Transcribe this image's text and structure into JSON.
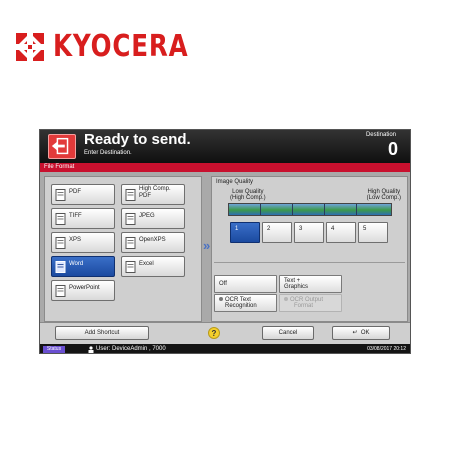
{
  "brand": {
    "name": "KYOCERA",
    "color": "#d81e1e"
  },
  "header": {
    "icon": "send-icon",
    "title": "Ready to send.",
    "subtitle": "Enter Destination.",
    "destination_label": "Destination",
    "destination_count": "0"
  },
  "tab": {
    "label": "File Format"
  },
  "file_formats": {
    "selected": "Word",
    "items": [
      {
        "label": "PDF",
        "selected": false
      },
      {
        "label": "High Comp. PDF",
        "selected": false
      },
      {
        "label": "TIFF",
        "selected": false
      },
      {
        "label": "JPEG",
        "selected": false
      },
      {
        "label": "XPS",
        "selected": false
      },
      {
        "label": "OpenXPS",
        "selected": false
      },
      {
        "label": "Word",
        "selected": true
      },
      {
        "label": "Excel",
        "selected": false
      },
      {
        "label": "PowerPoint",
        "selected": false
      }
    ]
  },
  "image_quality": {
    "title": "Image Quality",
    "low_label": "Low Quality",
    "low_sub": "(High Comp.)",
    "high_label": "High Quality",
    "high_sub": "(Low Comp.)",
    "levels": [
      "1",
      "2",
      "3",
      "4",
      "5"
    ],
    "selected_level": "1"
  },
  "ocr_options": {
    "off_label": "Off",
    "text_graphics_label": "Text +",
    "text_graphics_label2": "Graphics",
    "ocr_text_label": "OCR Text",
    "ocr_text_label2": "Recognition",
    "ocr_output_label": "OCR Output",
    "ocr_output_label2": "Format"
  },
  "footer": {
    "add_shortcut": "Add Shortcut",
    "help_icon": "help-icon",
    "cancel": "Cancel",
    "ok": "OK"
  },
  "status": {
    "badge": "Status",
    "user": "User: DeviceAdmin , 7000",
    "datetime": "03/08/2017 20:12"
  },
  "colors": {
    "header_bg": "#1a1a1a",
    "tab_red": "#c8102e",
    "selected_blue": "#1b4aa0",
    "panel_gray": "#cfcfcf",
    "status_badge": "#6a4fd1",
    "help_yellow": "#f4cf2b"
  }
}
